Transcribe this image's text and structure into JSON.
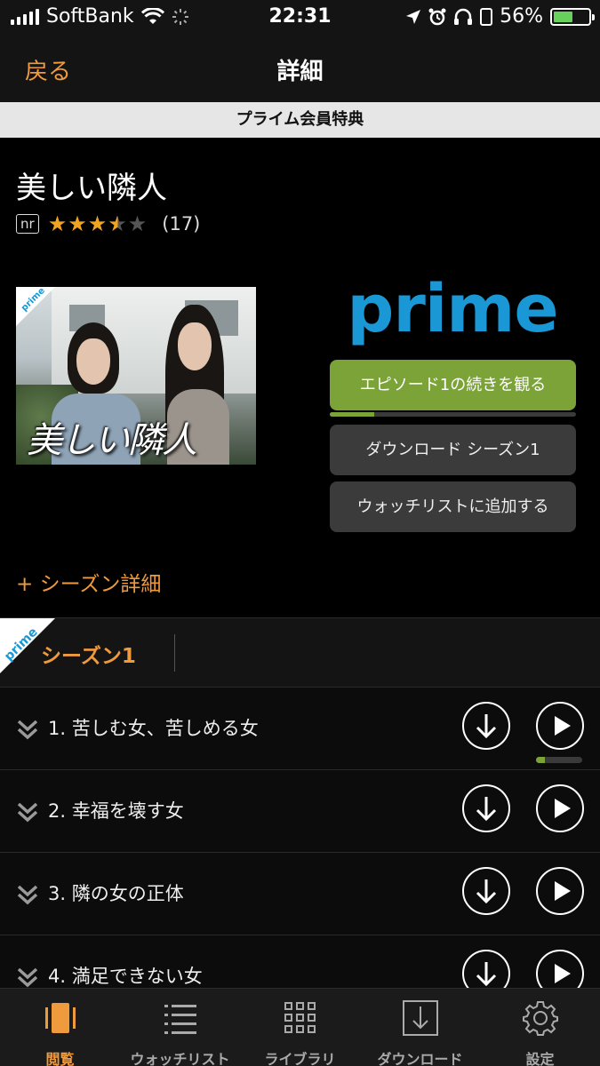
{
  "status_bar": {
    "carrier": "SoftBank",
    "time": "22:31",
    "battery": "56%",
    "battery_level": 0.56
  },
  "nav": {
    "back_label": "戻る",
    "title": "詳細"
  },
  "banner": {
    "text": "プライム会員特典"
  },
  "show": {
    "title": "美しい隣人",
    "maturity": "nr",
    "rating": 3.5,
    "rating_max": 5,
    "review_count": "(17)",
    "thumbnail_text": "美しい隣人",
    "thumbnail_badge": "prime"
  },
  "prime_logo": "prime",
  "actions": {
    "watch_label": "エピソード1の続きを観る",
    "watch_progress": 0.18,
    "download_label": "ダウンロード シーズン1",
    "watchlist_label": "ウォッチリストに追加する"
  },
  "season_detail_link": "+ シーズン詳細",
  "season_tabs": {
    "badge": "prime",
    "active": "シーズン1"
  },
  "episodes": [
    {
      "title": "1. 苦しむ女、苦しめる女",
      "progress": 0.2
    },
    {
      "title": "2. 幸福を壊す女"
    },
    {
      "title": "3. 隣の女の正体"
    },
    {
      "title": "4. 満足できない女"
    }
  ],
  "tab_bar": {
    "tabs": [
      {
        "label": "閲覧",
        "icon": "browse-icon",
        "active": true
      },
      {
        "label": "ウォッチリスト",
        "icon": "watchlist-icon"
      },
      {
        "label": "ライブラリ",
        "icon": "library-grid-icon"
      },
      {
        "label": "ダウンロード",
        "icon": "download-icon"
      },
      {
        "label": "設定",
        "icon": "gear-icon"
      }
    ]
  },
  "colors": {
    "accent": "#f09a3e",
    "prime_blue": "#1a98d5",
    "watch_green": "#7ba337",
    "star": "#f0a420"
  }
}
